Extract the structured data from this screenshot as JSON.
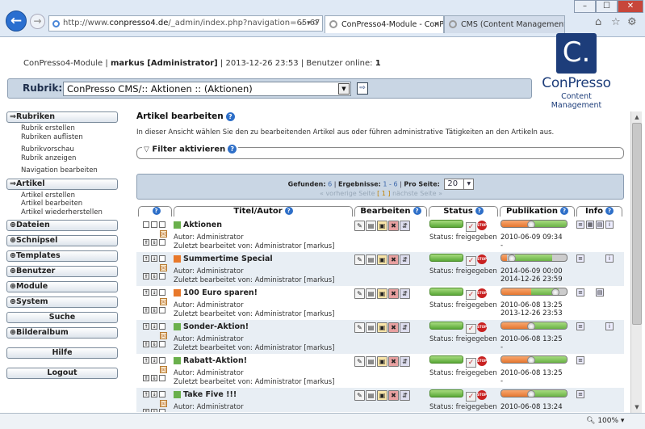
{
  "browser": {
    "url_prefix": "http://www.",
    "url_domain": "conpresso4.de",
    "url_path": "/_admin/index.php?navigation=65:67",
    "url_controls": "⌕ ▾ ⟳",
    "tabs": [
      {
        "label": "ConPresso4-Module - ConP..."
      },
      {
        "label": "CMS (Content Management S..."
      }
    ],
    "zoom": "100%"
  },
  "header": {
    "module": "ConPresso4-Module",
    "user": "markus [Administrator]",
    "datetime": "2013-12-26 23:53",
    "online_label": "Benutzer online:",
    "online_count": "1",
    "sep": "|"
  },
  "logo": {
    "mark": "C.",
    "name": "ConPresso",
    "subtitle": "Content Management"
  },
  "rubrik": {
    "label": "Rubrik:",
    "selected": "ConPresso CMS/:: Aktionen :: (Aktionen)"
  },
  "sidebar": {
    "rubriken": {
      "title": "⇒Rubriken",
      "items": [
        "Rubrik erstellen",
        "Rubriken auflisten",
        "Rubrikvorschau",
        "Rubrik anzeigen",
        "Navigation bearbeiten"
      ]
    },
    "artikel": {
      "title": "⇒Artikel",
      "items": [
        "Artikel erstellen",
        "Artikel bearbeiten",
        "Artikel wiederherstellen"
      ]
    },
    "closed": [
      "⊕Dateien",
      "⊕Schnipsel",
      "⊕Templates",
      "⊕Benutzer",
      "⊕Module",
      "⊕System"
    ],
    "suche": "Suche",
    "bilderalbum": "⊕Bilderalbum",
    "hilfe": "Hilfe",
    "logout": "Logout"
  },
  "main": {
    "title": "Artikel bearbeiten",
    "description": "In dieser Ansicht wählen Sie den zu bearbeitenden Artikel aus oder führen administrative Tätigkeiten an den Artikeln aus.",
    "filter_label": "Filter aktivieren",
    "found_label": "Gefunden:",
    "found": "6",
    "results_label": "Ergebnisse:",
    "results": "1 - 6",
    "perpage_label": "Pro Seite:",
    "perpage": "20",
    "pager_prev": "« vorherige Seite",
    "pager_current": "[ 1 ]",
    "pager_next": "nächste Seite »",
    "help_mark": "?"
  },
  "grid": {
    "headers": {
      "title": "Titel/Autor",
      "edit": "Bearbeiten",
      "status": "Status",
      "pub": "Publikation",
      "info": "Info"
    },
    "rows": [
      {
        "title": "Aktionen",
        "color": "#6ab04c",
        "author": "Autor: Administrator",
        "edited": "Zuletzt bearbeitet von: Administrator [markus]",
        "status": "Status: freigegeben",
        "pub_from": "2010-06-09 09:34",
        "pub_to": "-",
        "pub_fill": 1.0
      },
      {
        "title": "Summertime Special",
        "color": "#e8782a",
        "author": "Autor: Administrator",
        "edited": "Zuletzt bearbeitet von: Administrator [markus]",
        "status": "Status: freigegeben",
        "pub_from": "2014-06-09 00:00",
        "pub_to": "2014-12-26 23:59",
        "pub_fill": 0.1
      },
      {
        "title": "100 Euro sparen!",
        "color": "#e8782a",
        "author": "Autor: Administrator",
        "edited": "Zuletzt bearbeitet von: Administrator [markus]",
        "status": "Status: freigegeben",
        "pub_from": "2010-06-08 13:25",
        "pub_to": "2013-12-26 23:53",
        "pub_fill": 0.85
      },
      {
        "title": "Sonder-Aktion!",
        "color": "#6ab04c",
        "author": "Autor: Administrator",
        "edited": "Zuletzt bearbeitet von: Administrator [markus]",
        "status": "Status: freigegeben",
        "pub_from": "2010-06-08 13:25",
        "pub_to": "-",
        "pub_fill": 1.0
      },
      {
        "title": "Rabatt-Aktion!",
        "color": "#6ab04c",
        "author": "Autor: Administrator",
        "edited": "Zuletzt bearbeitet von: Administrator [markus]",
        "status": "Status: freigegeben",
        "pub_from": "2010-06-08 13:25",
        "pub_to": "-",
        "pub_fill": 1.0
      },
      {
        "title": "Take Five !!!",
        "color": "#6ab04c",
        "author": "Autor: Administrator",
        "edited": "",
        "status": "Status: freigegeben",
        "pub_from": "2010-06-08 13:24",
        "pub_to": "",
        "pub_fill": 1.0
      }
    ]
  },
  "colors": {
    "accent": "#1d3d7a",
    "bar_bg": "#c9d6e4",
    "green": "#6ab04c",
    "orange": "#e8782a"
  }
}
